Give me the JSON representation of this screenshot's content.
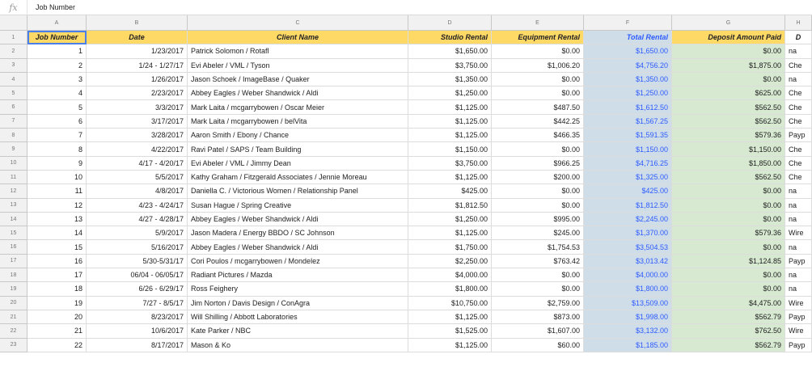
{
  "formula_bar": {
    "fx": "fx",
    "value": "Job Number"
  },
  "column_letters": [
    "A",
    "B",
    "C",
    "D",
    "E",
    "F",
    "G",
    "H"
  ],
  "headers": [
    "Job Number",
    "Date",
    "Client Name",
    "Studio Rental",
    "Equipment Rental",
    "Total Rental",
    "Deposit Amount Paid",
    "D"
  ],
  "rows": [
    [
      "1",
      "1/23/2017",
      "Patrick Solomon / Rotafl",
      "$1,650.00",
      "$0.00",
      "$1,650.00",
      "$0.00",
      "na"
    ],
    [
      "2",
      "1/24 - 1/27/17",
      "Evi Abeler / VML / Tyson",
      "$3,750.00",
      "$1,006.20",
      "$4,756.20",
      "$1,875.00",
      "Che"
    ],
    [
      "3",
      "1/26/2017",
      "Jason Schoek / ImageBase / Quaker",
      "$1,350.00",
      "$0.00",
      "$1,350.00",
      "$0.00",
      "na"
    ],
    [
      "4",
      "2/23/2017",
      "Abbey Eagles / Weber Shandwick / Aldi",
      "$1,250.00",
      "$0.00",
      "$1,250.00",
      "$625.00",
      "Che"
    ],
    [
      "5",
      "3/3/2017",
      "Mark Laita / mcgarrybowen / Oscar Meier",
      "$1,125.00",
      "$487.50",
      "$1,612.50",
      "$562.50",
      "Che"
    ],
    [
      "6",
      "3/17/2017",
      "Mark Laita / mcgarrybowen / belVita",
      "$1,125.00",
      "$442.25",
      "$1,567.25",
      "$562.50",
      "Che"
    ],
    [
      "7",
      "3/28/2017",
      "Aaron Smith / Ebony / Chance",
      "$1,125.00",
      "$466.35",
      "$1,591.35",
      "$579.36",
      "Payp"
    ],
    [
      "8",
      "4/22/2017",
      "Ravi Patel / SAPS / Team Building",
      "$1,150.00",
      "$0.00",
      "$1,150.00",
      "$1,150.00",
      "Che"
    ],
    [
      "9",
      "4/17 - 4/20/17",
      "Evi Abeler / VML / Jimmy Dean",
      "$3,750.00",
      "$966.25",
      "$4,716.25",
      "$1,850.00",
      "Che"
    ],
    [
      "10",
      "5/5/2017",
      "Kathy Graham / Fitzgerald Associates / Jennie Moreau",
      "$1,125.00",
      "$200.00",
      "$1,325.00",
      "$562.50",
      "Che"
    ],
    [
      "11",
      "4/8/2017",
      "Daniella C. / Victorious Women / Relationship Panel",
      "$425.00",
      "$0.00",
      "$425.00",
      "$0.00",
      "na"
    ],
    [
      "12",
      "4/23 - 4/24/17",
      "Susan Hague / Spring Creative",
      "$1,812.50",
      "$0.00",
      "$1,812.50",
      "$0.00",
      "na"
    ],
    [
      "13",
      "4/27 - 4/28/17",
      "Abbey Eagles / Weber Shandwick / Aldi",
      "$1,250.00",
      "$995.00",
      "$2,245.00",
      "$0.00",
      "na"
    ],
    [
      "14",
      "5/9/2017",
      "Jason Madera / Energy BBDO / SC Johnson",
      "$1,125.00",
      "$245.00",
      "$1,370.00",
      "$579.36",
      "Wire"
    ],
    [
      "15",
      "5/16/2017",
      "Abbey Eagles / Weber Shandwick / Aldi",
      "$1,750.00",
      "$1,754.53",
      "$3,504.53",
      "$0.00",
      "na"
    ],
    [
      "16",
      "5/30-5/31/17",
      "Cori Poulos / mcgarrybowen / Mondelez",
      "$2,250.00",
      "$763.42",
      "$3,013.42",
      "$1,124.85",
      "Payp"
    ],
    [
      "17",
      "06/04 - 06/05/17",
      "Radiant Pictures / Mazda",
      "$4,000.00",
      "$0.00",
      "$4,000.00",
      "$0.00",
      "na"
    ],
    [
      "18",
      "6/26 - 6/29/17",
      "Ross Feighery",
      "$1,800.00",
      "$0.00",
      "$1,800.00",
      "$0.00",
      "na"
    ],
    [
      "19",
      "7/27 - 8/5/17",
      "Jim Norton / Davis Design / ConAgra",
      "$10,750.00",
      "$2,759.00",
      "$13,509.00",
      "$4,475.00",
      "Wire"
    ],
    [
      "20",
      "8/23/2017",
      "Will Shilling / Abbott Laboratories",
      "$1,125.00",
      "$873.00",
      "$1,998.00",
      "$562.79",
      "Payp"
    ],
    [
      "21",
      "10/6/2017",
      "Kate Parker / NBC",
      "$1,525.00",
      "$1,607.00",
      "$3,132.00",
      "$762.50",
      "Wire"
    ],
    [
      "22",
      "8/17/2017",
      "Mason & Ko",
      "$1,125.00",
      "$60.00",
      "$1,185.00",
      "$562.79",
      "Payp"
    ]
  ]
}
